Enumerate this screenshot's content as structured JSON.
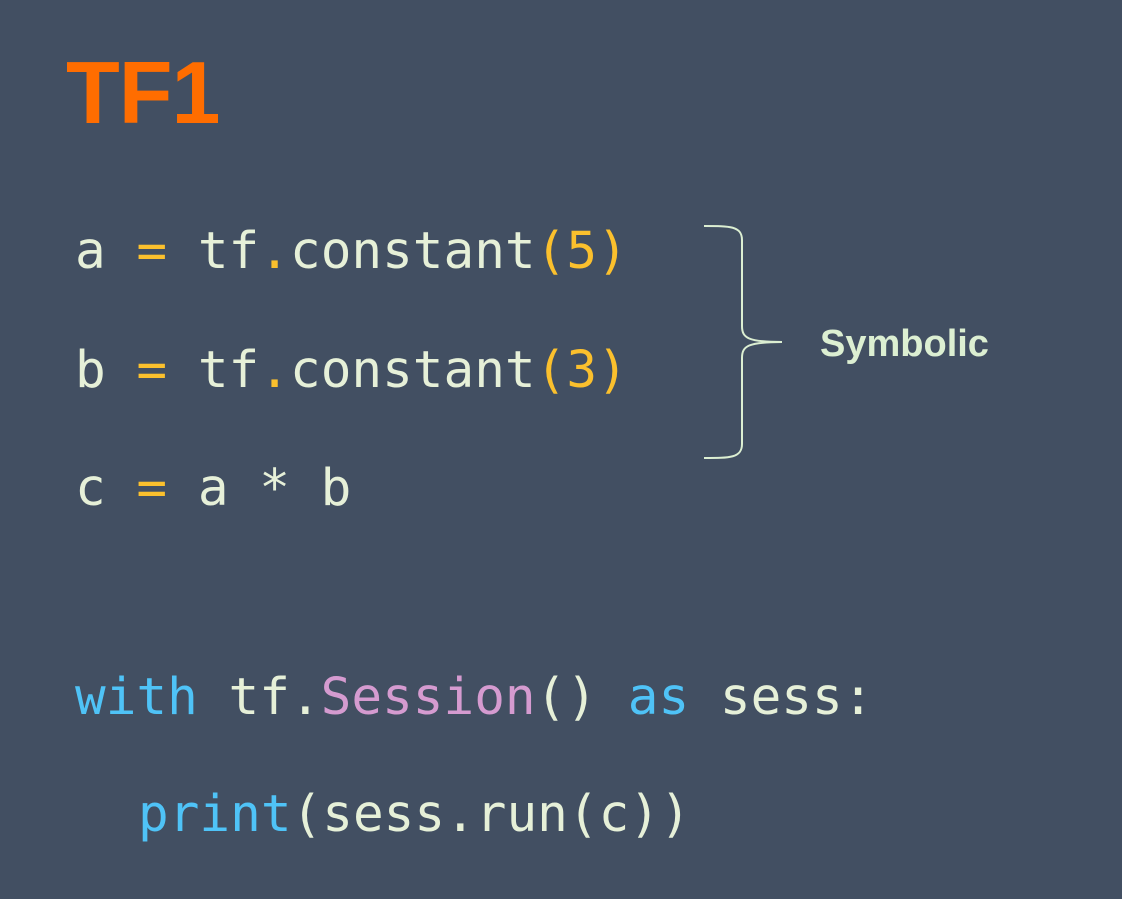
{
  "slide": {
    "title": "TF1",
    "annotation": "Symbolic"
  },
  "code": {
    "line1": {
      "var": "a",
      "op": " = ",
      "obj": "tf",
      "dot": ".",
      "func": "constant",
      "open": "(",
      "arg": "5",
      "close": ")"
    },
    "line2": {
      "var": "b",
      "op": " = ",
      "obj": "tf",
      "dot": ".",
      "func": "constant",
      "open": "(",
      "arg": "3",
      "close": ")"
    },
    "line3": {
      "var": "c",
      "op": " = ",
      "rest": "a * b"
    },
    "line4": {
      "kw_with": "with",
      "sp1": " ",
      "obj": "tf.",
      "cls": "Session",
      "parens": "()",
      "sp2": " ",
      "kw_as": "as",
      "rest": " sess:"
    },
    "line5": {
      "func": "print",
      "rest": "(sess.run(c))"
    }
  },
  "colors": {
    "background": "#424f62",
    "title": "#ff6d00",
    "identifier": "#e6f0d8",
    "operator": "#fbc02d",
    "keyword": "#4fc3f7",
    "class": "#d59bd0"
  }
}
